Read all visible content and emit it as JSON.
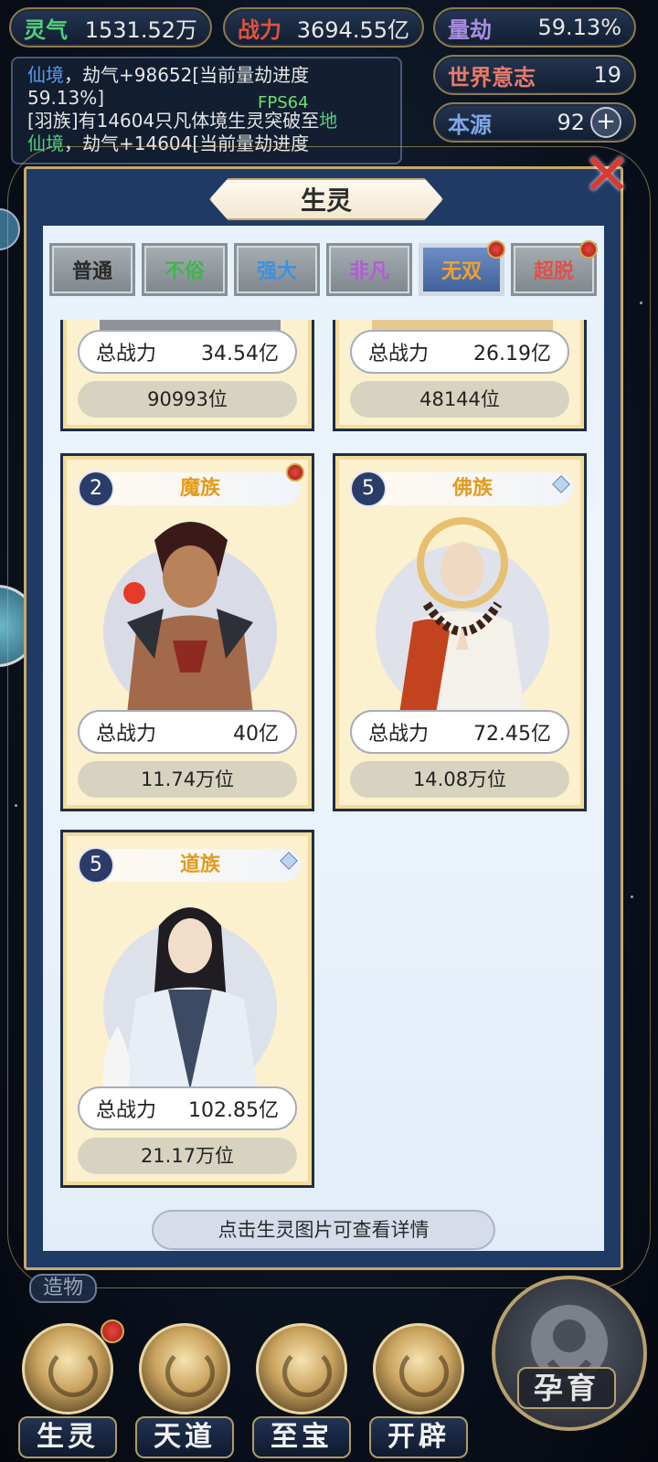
{
  "stats": {
    "lingqi": {
      "label": "灵气",
      "value": "1531.52万",
      "color": "#4fd07a"
    },
    "zhanli": {
      "label": "战力",
      "value": "3694.55亿",
      "color": "#e0523e"
    },
    "liangjie": {
      "label": "量劫",
      "value": "59.13%",
      "color": "#a98ee0"
    },
    "shijie": {
      "label": "世界意志",
      "value": "19",
      "color": "#e87a6a"
    },
    "benyuan": {
      "label": "本源",
      "value": "92",
      "color": "#7fa6e8"
    }
  },
  "log": {
    "line1_highlight": "仙境",
    "line1_rest": "，劫气+98652[当前量劫进度",
    "line2": "59.13%]",
    "line3_rest": "[羽族]有14604只凡体境生灵突破至",
    "line3_highlight": "地",
    "line4_highlight": "仙境",
    "line4_rest": "，劫气+14604[当前量劫进度"
  },
  "fps": "FPS64",
  "modal": {
    "title": "生灵",
    "tabs": [
      {
        "label": "普通",
        "color": "#2a2a2a",
        "dot": false,
        "active": false
      },
      {
        "label": "不俗",
        "color": "#3fb64a",
        "dot": false,
        "active": false
      },
      {
        "label": "强大",
        "color": "#3e8fe0",
        "dot": false,
        "active": false
      },
      {
        "label": "非凡",
        "color": "#b35ad8",
        "dot": false,
        "active": false
      },
      {
        "label": "无双",
        "color": "#f0a22a",
        "dot": true,
        "active": true
      },
      {
        "label": "超脱",
        "color": "#e0504a",
        "dot": true,
        "active": false
      }
    ],
    "hint": "点击生灵图片可查看详情"
  },
  "cards": [
    {
      "power_label": "总战力",
      "power": "34.54亿",
      "rank": "90993位"
    },
    {
      "power_label": "总战力",
      "power": "26.19亿",
      "rank": "48144位"
    },
    {
      "level": "2",
      "race": "魔族",
      "power_label": "总战力",
      "power": "40亿",
      "rank": "11.74万位",
      "dot": true
    },
    {
      "level": "5",
      "race": "佛族",
      "power_label": "总战力",
      "power": "72.45亿",
      "rank": "14.08万位",
      "dot": false
    },
    {
      "level": "5",
      "race": "道族",
      "power_label": "总战力",
      "power": "102.85亿",
      "rank": "21.17万位",
      "dot": false
    }
  ],
  "bottom": {
    "zaowu": "造物",
    "nav": [
      "生灵",
      "天道",
      "至宝",
      "开辟"
    ],
    "yunyu": "孕育"
  }
}
